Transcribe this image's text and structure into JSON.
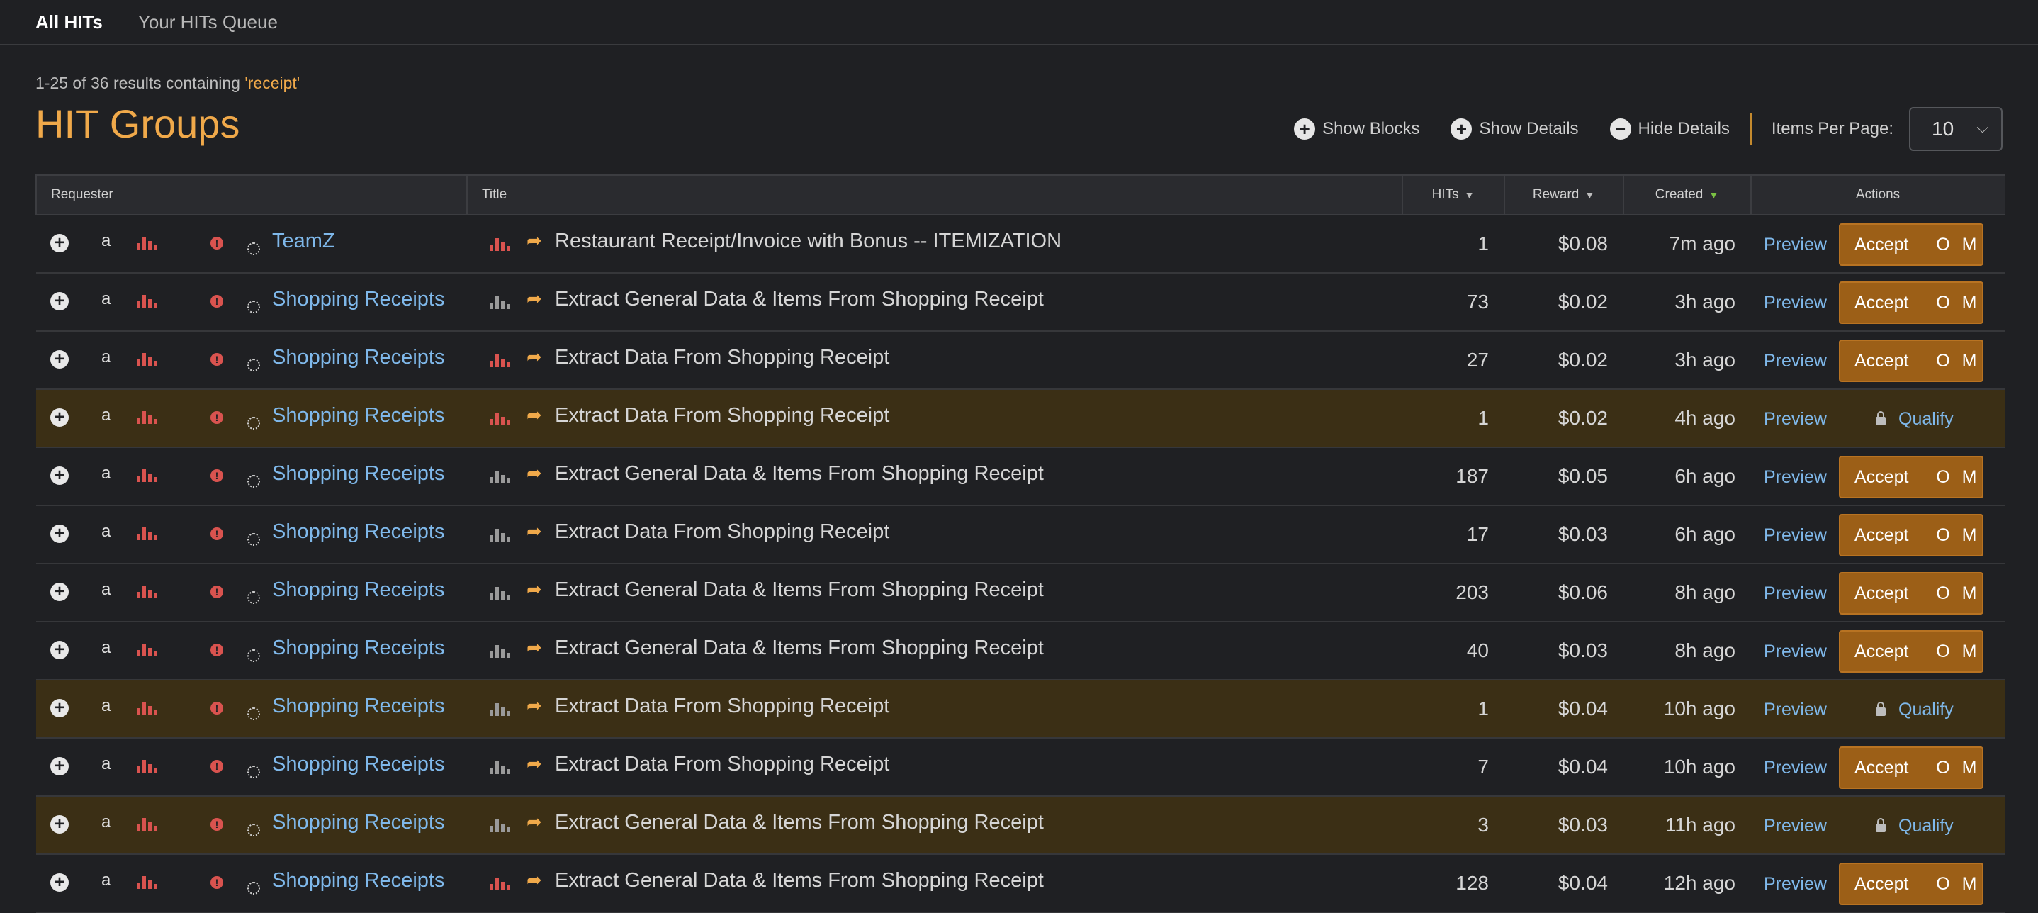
{
  "nav": {
    "tabs": [
      {
        "label": "All HITs"
      },
      {
        "label": "Your HITs Queue"
      }
    ]
  },
  "results": {
    "prefix": "1-25 of 36 results containing ",
    "query": "'receipt'"
  },
  "page_title": "HIT Groups",
  "controls": {
    "show_blocks": "Show Blocks",
    "show_details": "Show Details",
    "hide_details": "Hide Details",
    "items_per_page_label": "Items Per Page:",
    "items_per_page_value": "10"
  },
  "columns": {
    "requester": "Requester",
    "title": "Title",
    "hits": "HITs",
    "reward": "Reward",
    "created": "Created",
    "actions": "Actions"
  },
  "labels": {
    "preview": "Preview",
    "accept": "Accept",
    "o": "O",
    "m": "M",
    "qualify": "Qualify",
    "amazon_glyph": "a"
  },
  "colors": {
    "accent": "#f0a94a",
    "link": "#7fb8ea",
    "accept_bg": "#9c5f17",
    "qualify_row_bg": "#3b2f15"
  },
  "rows": [
    {
      "requester": "TeamZ",
      "title": "Restaurant Receipt/Invoice with Bonus -- ITEMIZATION",
      "hits": "1",
      "reward": "$0.08",
      "created": "7m ago",
      "action": "accept",
      "title_bars": "red"
    },
    {
      "requester": "Shopping Receipts",
      "title": "Extract General Data & Items From Shopping Receipt",
      "hits": "73",
      "reward": "$0.02",
      "created": "3h ago",
      "action": "accept",
      "title_bars": "gray"
    },
    {
      "requester": "Shopping Receipts",
      "title": "Extract Data From Shopping Receipt",
      "hits": "27",
      "reward": "$0.02",
      "created": "3h ago",
      "action": "accept",
      "title_bars": "red"
    },
    {
      "requester": "Shopping Receipts",
      "title": "Extract Data From Shopping Receipt",
      "hits": "1",
      "reward": "$0.02",
      "created": "4h ago",
      "action": "qualify",
      "title_bars": "red"
    },
    {
      "requester": "Shopping Receipts",
      "title": "Extract General Data & Items From Shopping Receipt",
      "hits": "187",
      "reward": "$0.05",
      "created": "6h ago",
      "action": "accept",
      "title_bars": "gray"
    },
    {
      "requester": "Shopping Receipts",
      "title": "Extract Data From Shopping Receipt",
      "hits": "17",
      "reward": "$0.03",
      "created": "6h ago",
      "action": "accept",
      "title_bars": "gray"
    },
    {
      "requester": "Shopping Receipts",
      "title": "Extract General Data & Items From Shopping Receipt",
      "hits": "203",
      "reward": "$0.06",
      "created": "8h ago",
      "action": "accept",
      "title_bars": "gray"
    },
    {
      "requester": "Shopping Receipts",
      "title": "Extract General Data & Items From Shopping Receipt",
      "hits": "40",
      "reward": "$0.03",
      "created": "8h ago",
      "action": "accept",
      "title_bars": "gray"
    },
    {
      "requester": "Shopping Receipts",
      "title": "Extract Data From Shopping Receipt",
      "hits": "1",
      "reward": "$0.04",
      "created": "10h ago",
      "action": "qualify",
      "title_bars": "gray"
    },
    {
      "requester": "Shopping Receipts",
      "title": "Extract Data From Shopping Receipt",
      "hits": "7",
      "reward": "$0.04",
      "created": "10h ago",
      "action": "accept",
      "title_bars": "gray"
    },
    {
      "requester": "Shopping Receipts",
      "title": "Extract General Data & Items From Shopping Receipt",
      "hits": "3",
      "reward": "$0.03",
      "created": "11h ago",
      "action": "qualify",
      "title_bars": "gray"
    },
    {
      "requester": "Shopping Receipts",
      "title": "Extract General Data & Items From Shopping Receipt",
      "hits": "128",
      "reward": "$0.04",
      "created": "12h ago",
      "action": "accept",
      "title_bars": "red"
    }
  ]
}
